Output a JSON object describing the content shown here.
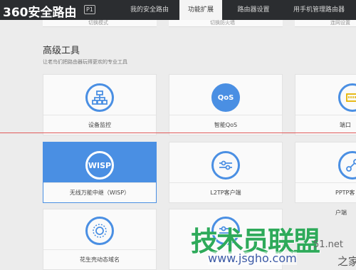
{
  "header": {
    "logo": "360安全路由",
    "model_badge": "P1",
    "tabs": [
      {
        "label": "我的安全路由"
      },
      {
        "label": "功能扩展"
      },
      {
        "label": "路由器设置"
      },
      {
        "label": "用手机管理路由器"
      }
    ]
  },
  "previous_row": [
    {
      "label": "切换模式"
    },
    {
      "label": "切换防火墙"
    },
    {
      "label": "连网设置"
    }
  ],
  "section": {
    "title": "高级工具",
    "subtitle": "让老鸟们把路由器玩得更欢的专业工具"
  },
  "cards": [
    {
      "label": "设备监控",
      "icon": "network-topology-icon"
    },
    {
      "label": "智能QoS",
      "icon_text": "QoS"
    },
    {
      "label": "端口映射",
      "icon": "port-icon"
    },
    {
      "label": "无线万能中继（WISP）",
      "icon_text": "WISP",
      "selected": true
    },
    {
      "label": "L2TP客户端",
      "icon": "sliders-icon"
    },
    {
      "label": "PPTP客户端",
      "icon": "link-icon"
    },
    {
      "label": "花生壳动态域名",
      "icon": "peanut-ring-icon"
    },
    {
      "label": "",
      "icon": "sliders-icon"
    }
  ],
  "watermark": {
    "main": "技术员联盟",
    "url": "www.jsgho.com",
    "side1": "51.net",
    "side2": "之家"
  }
}
